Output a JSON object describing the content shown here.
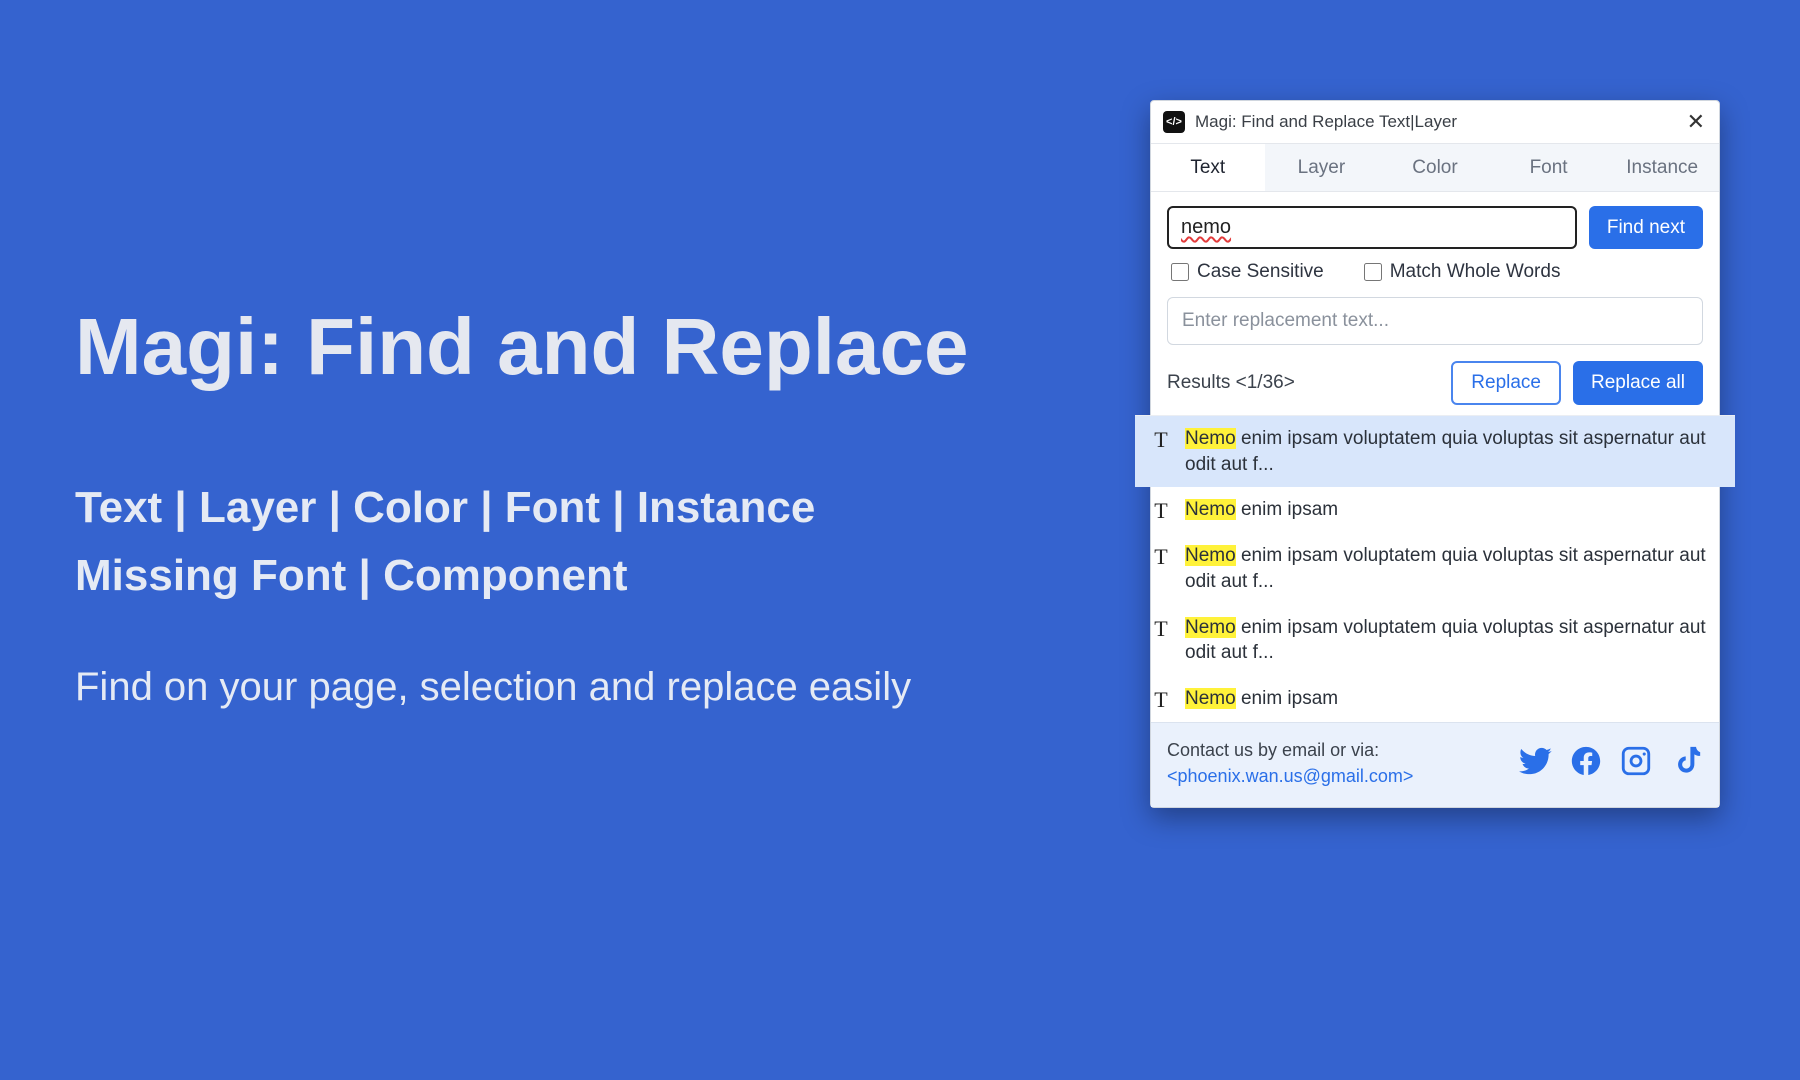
{
  "promo": {
    "title": "Magi: Find and Replace",
    "cats_line1": "Text | Layer | Color | Font | Instance",
    "cats_line2": "Missing Font | Component",
    "tagline": "Find on your page, selection and replace easily"
  },
  "window": {
    "title": "Magi: Find and Replace Text|Layer",
    "tabs": [
      "Text",
      "Layer",
      "Color",
      "Font",
      "Instance"
    ],
    "active_tab": "Text",
    "search_value": "nemo",
    "find_next": "Find next",
    "case_sensitive": "Case Sensitive",
    "match_whole": "Match Whole Words",
    "replace_placeholder": "Enter replacement text...",
    "replace": "Replace",
    "replace_all": "Replace all",
    "results_label": "Results <1/36>"
  },
  "results": [
    {
      "highlight": "Nemo",
      "rest": " enim ipsam voluptatem quia voluptas sit aspernatur aut odit aut f..."
    },
    {
      "highlight": "Nemo",
      "rest": " enim ipsam"
    },
    {
      "highlight": "Nemo",
      "rest": " enim ipsam voluptatem quia voluptas sit aspernatur aut odit aut f..."
    },
    {
      "highlight": "Nemo",
      "rest": " enim ipsam voluptatem quia voluptas sit aspernatur aut odit aut f..."
    },
    {
      "highlight": "Nemo",
      "rest": " enim ipsam"
    }
  ],
  "footer": {
    "contact_line": "Contact us by email or via:",
    "email": "<phoenix.wan.us@gmail.com>"
  }
}
